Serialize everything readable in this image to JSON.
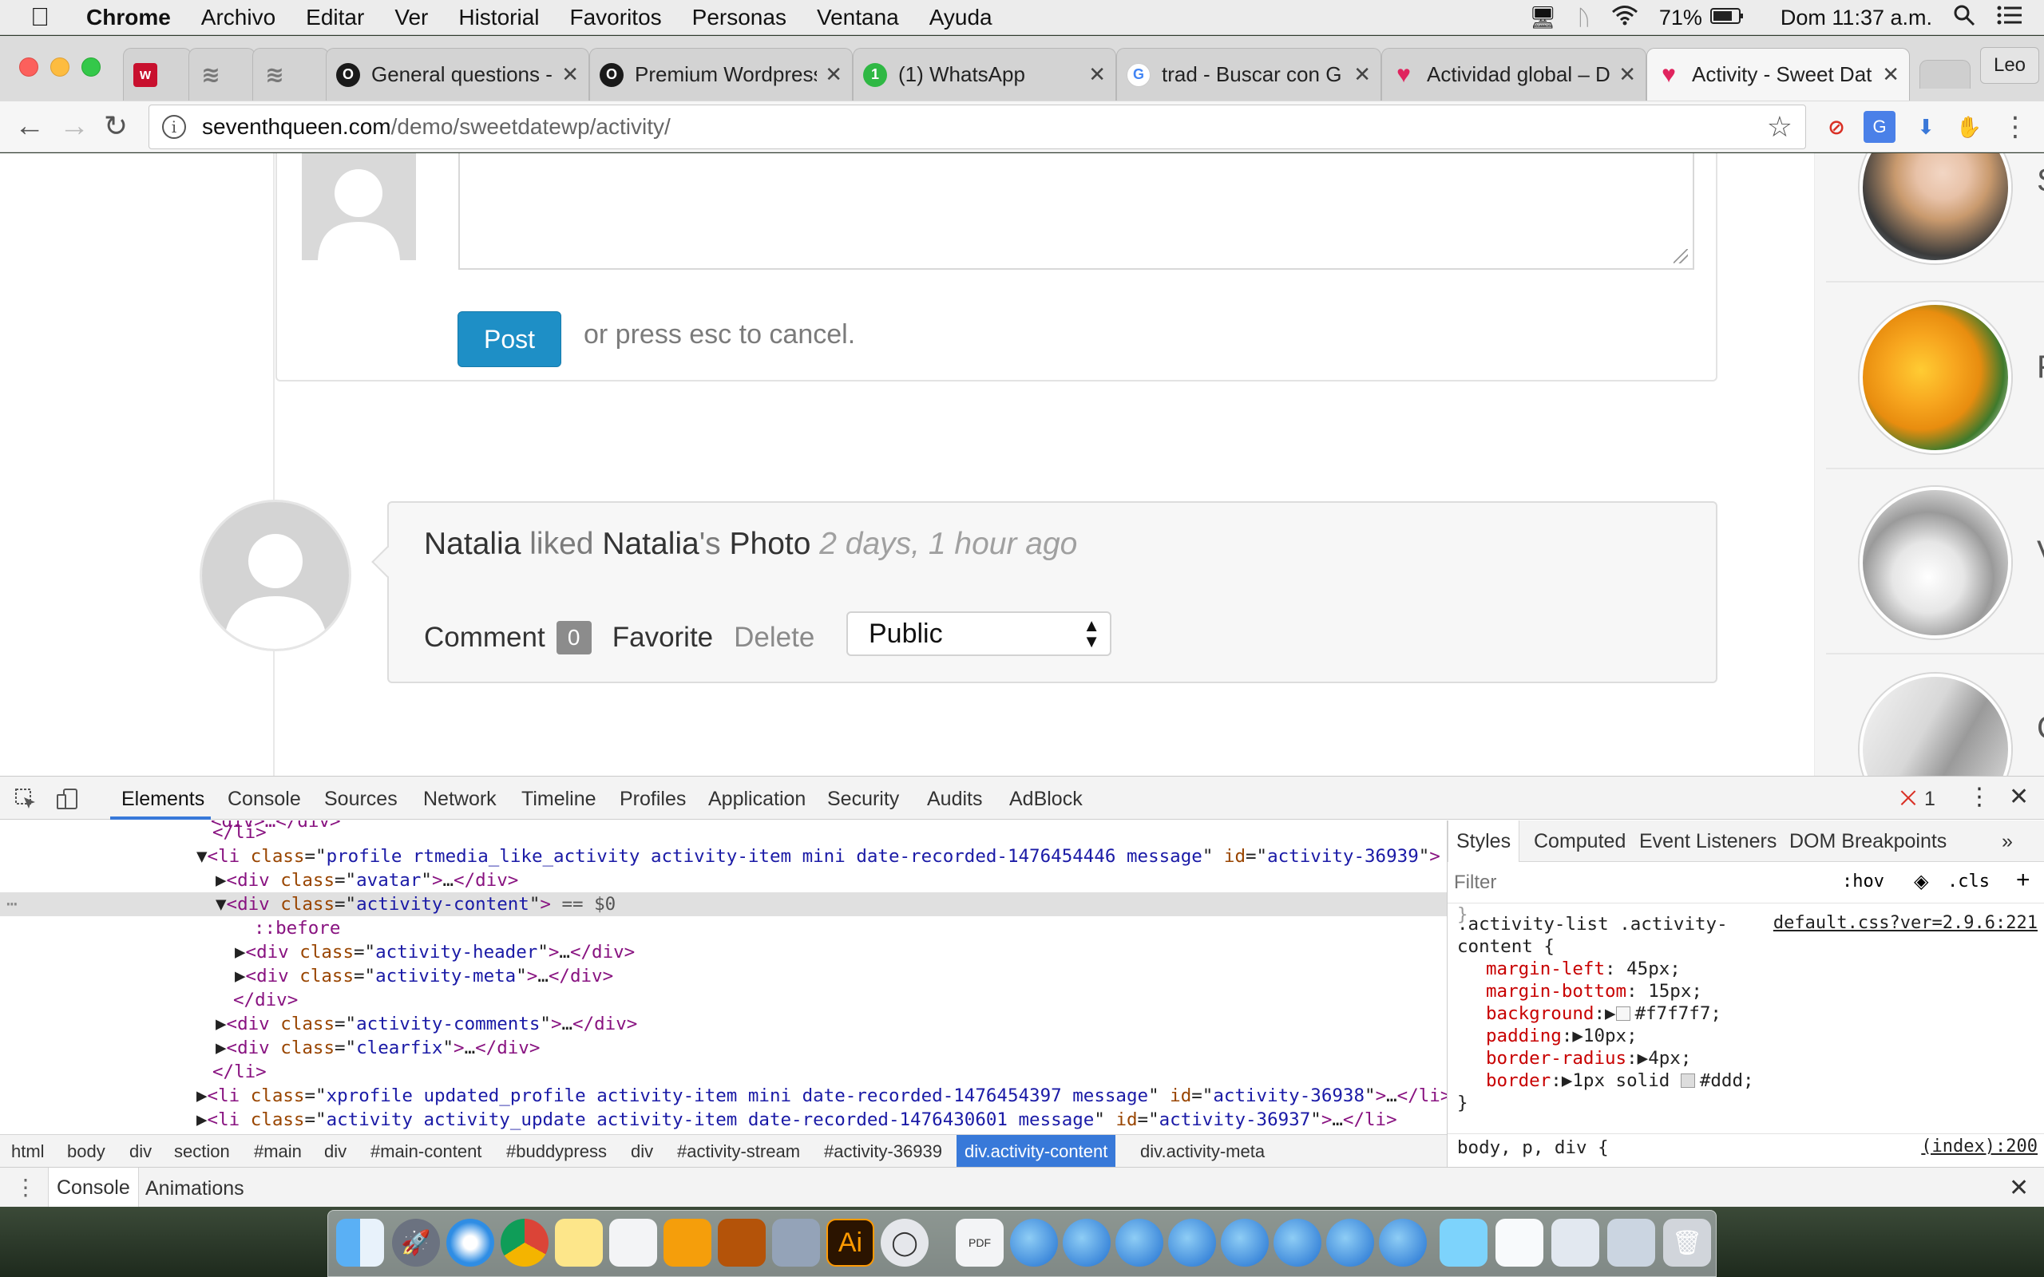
{
  "menubar": {
    "app": "Chrome",
    "items": [
      "Archivo",
      "Editar",
      "Ver",
      "Historial",
      "Favoritos",
      "Personas",
      "Ventana",
      "Ayuda"
    ],
    "battery": "71%",
    "clock": "Dom 11:37 a.m."
  },
  "tabs": [
    {
      "title": "",
      "favicon": "w-icon",
      "color": "#c8102e",
      "glyph": "w"
    },
    {
      "title": "",
      "favicon": "wave-icon",
      "color": "#777777",
      "glyph": "≋"
    },
    {
      "title": "",
      "favicon": "wave-icon",
      "color": "#777777",
      "glyph": "≋"
    },
    {
      "title": "General questions -",
      "favicon": "o-logo-icon",
      "color": "#1a1a1a",
      "glyph": "O"
    },
    {
      "title": "Premium Wordpress",
      "favicon": "o-logo-icon",
      "color": "#1a1a1a",
      "glyph": "O"
    },
    {
      "title": "(1) WhatsApp",
      "favicon": "whatsapp-icon",
      "color": "#2fb844",
      "glyph": "1"
    },
    {
      "title": "trad - Buscar con G",
      "favicon": "google-icon",
      "color": "#4285f4",
      "glyph": "G"
    },
    {
      "title": "Actividad global – D",
      "favicon": "heart-icon",
      "color": "#e0245e",
      "glyph": "♥"
    },
    {
      "title": "Activity - Sweet Dat",
      "favicon": "heart-icon",
      "color": "#e0245e",
      "glyph": "♥"
    }
  ],
  "profile_button": "Leo",
  "address": {
    "host": "seventhqueen.com",
    "path": "/demo/sweetdatewp/activity/"
  },
  "page": {
    "post_button": "Post",
    "cancel_hint": "or press esc to cancel.",
    "activity": {
      "user": "Natalia",
      "verb": "liked",
      "object_owner": "Natalia",
      "object_suffix": "'s",
      "object": "Photo",
      "time": "2 days, 1 hour ago",
      "comment_label": "Comment",
      "comment_count": "0",
      "favorite_label": "Favorite",
      "delete_label": "Delete",
      "privacy": "Public"
    },
    "members": [
      {
        "initial": "S"
      },
      {
        "initial": "F"
      },
      {
        "initial": "V"
      },
      {
        "initial": "C"
      }
    ]
  },
  "devtools": {
    "tabs": [
      "Elements",
      "Console",
      "Sources",
      "Network",
      "Timeline",
      "Profiles",
      "Application",
      "Security",
      "Audits",
      "AdBlock"
    ],
    "error_count": "1",
    "dom": {
      "l0_tag": "</li>",
      "l1": {
        "tag": "li",
        "class": "profile rtmedia_like_activity activity-item mini date-recorded-1476454446 message",
        "id": "activity-36939"
      },
      "l2": {
        "tag": "div",
        "class": "avatar"
      },
      "l3": {
        "tag": "div",
        "class": "activity-content",
        "suffix": "== $0"
      },
      "l4": "::before",
      "l5": {
        "tag": "div",
        "class": "activity-header"
      },
      "l6": {
        "tag": "div",
        "class": "activity-meta"
      },
      "l7": "</div>",
      "l8": {
        "tag": "div",
        "class": "activity-comments"
      },
      "l9": {
        "tag": "div",
        "class": "clearfix"
      },
      "l10": "</li>",
      "l11": {
        "tag": "li",
        "class": "xprofile updated_profile activity-item mini date-recorded-1476454397 message",
        "id": "activity-36938"
      },
      "l12": {
        "tag": "li",
        "class": "activity activity_update activity-item date-recorded-1476430601 message",
        "id": "activity-36937"
      }
    },
    "breadcrumbs": [
      "html",
      "body",
      "div",
      "section",
      "#main",
      "div",
      "#main-content",
      "#buddypress",
      "div",
      "#activity-stream",
      "#activity-36939",
      "div.activity-content",
      "div.activity-meta"
    ],
    "styles_tabs": [
      "Styles",
      "Computed",
      "Event Listeners",
      "DOM Breakpoints"
    ],
    "filter_placeholder": "Filter",
    "hov": ":hov",
    "cls": ".cls",
    "rule": {
      "selector_line1": ".activity-list .activity-",
      "selector_line2": "content {",
      "source": "default.css?ver=2.9.6:221",
      "props": [
        {
          "name": "margin-left",
          "value": "45px;"
        },
        {
          "name": "margin-bottom",
          "value": "15px;"
        },
        {
          "name": "background",
          "value": "#f7f7f7;"
        },
        {
          "name": "padding",
          "value": "10px;"
        },
        {
          "name": "border-radius",
          "value": "4px;"
        },
        {
          "name": "border",
          "value": "1px solid #ddd;"
        }
      ],
      "close": "}"
    },
    "rule2": {
      "selector": "body, p, div {",
      "source": "(index):200"
    },
    "drawer_tabs": [
      "Console",
      "Animations"
    ]
  }
}
